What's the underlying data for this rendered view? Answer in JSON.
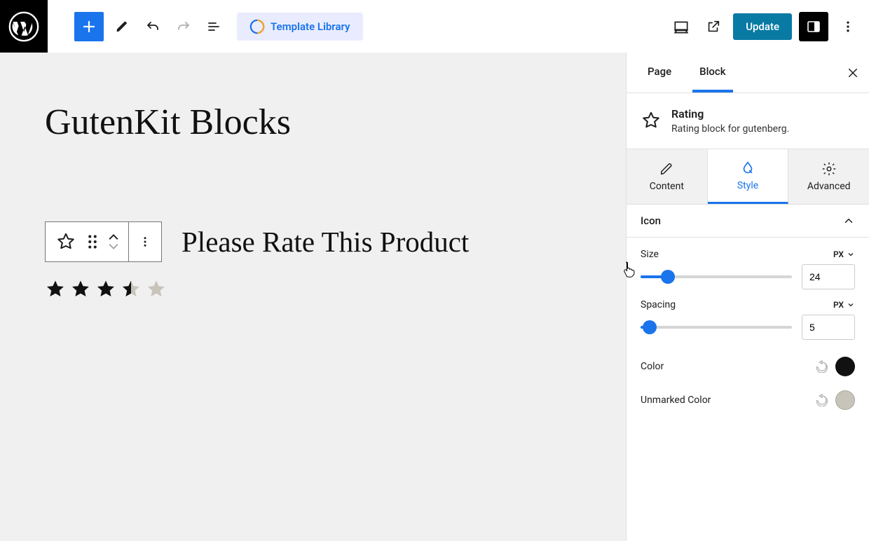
{
  "toolbar": {
    "template_library_label": "Template Library",
    "update_label": "Update"
  },
  "canvas": {
    "page_title": "GutenKit Blocks",
    "rate_prompt": "Please Rate This Product",
    "rating_value": 3.5,
    "rating_max": 5
  },
  "sidebar": {
    "tabs": {
      "page": "Page",
      "block": "Block"
    },
    "block_info": {
      "title": "Rating",
      "description": "Rating block for gutenberg."
    },
    "inspector_tabs": {
      "content": "Content",
      "style": "Style",
      "advanced": "Advanced"
    },
    "panels": {
      "icon": {
        "title": "Icon",
        "size": {
          "label": "Size",
          "unit": "PX",
          "value": "24",
          "pct": 18
        },
        "spacing": {
          "label": "Spacing",
          "unit": "PX",
          "value": "5",
          "pct": 6
        },
        "color": {
          "label": "Color",
          "value": "#111111"
        },
        "unmarked_color": {
          "label": "Unmarked Color",
          "value": "#c8c4b9"
        }
      }
    }
  }
}
